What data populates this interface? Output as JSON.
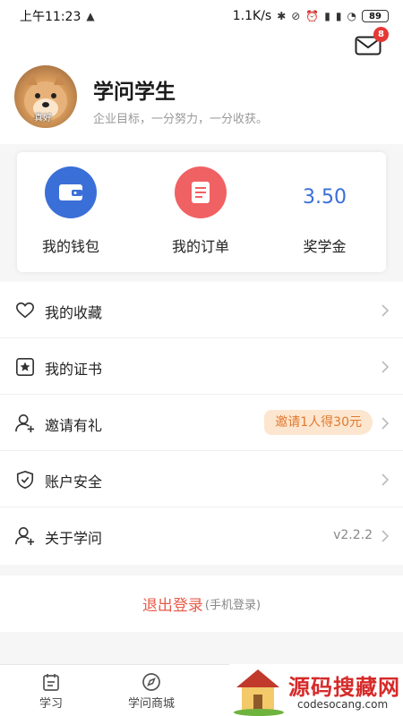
{
  "status_bar": {
    "time": "上午11:23",
    "network_speed": "1.1K/s",
    "battery": "89"
  },
  "header": {
    "mail_badge": "8"
  },
  "profile": {
    "avatar_tag": "真好",
    "name": "学问学生",
    "motto": "企业目标，一分努力，一分收获。"
  },
  "stats": [
    {
      "label": "我的钱包",
      "icon": "wallet-icon",
      "color": "#3a6fd8"
    },
    {
      "label": "我的订单",
      "icon": "order-icon",
      "color": "#f06163"
    },
    {
      "label": "奖学金",
      "value": "3.50",
      "color": "#3a6fd8"
    }
  ],
  "menu": [
    {
      "label": "我的收藏",
      "icon": "heart-icon"
    },
    {
      "label": "我的证书",
      "icon": "certificate-icon"
    },
    {
      "label": "邀请有礼",
      "icon": "invite-user-icon",
      "badge": "邀请1人得30元"
    },
    {
      "label": "账户安全",
      "icon": "shield-icon"
    },
    {
      "label": "关于学问",
      "icon": "about-user-icon",
      "version": "v2.2.2"
    }
  ],
  "logout": {
    "label": "退出登录",
    "sub": "(手机登录)"
  },
  "tabs": [
    {
      "label": "学习",
      "icon": "calendar-icon"
    },
    {
      "label": "学问商城",
      "icon": "compass-icon"
    }
  ],
  "watermark": {
    "text": "源码搜藏网",
    "url": "codesocang.com"
  }
}
